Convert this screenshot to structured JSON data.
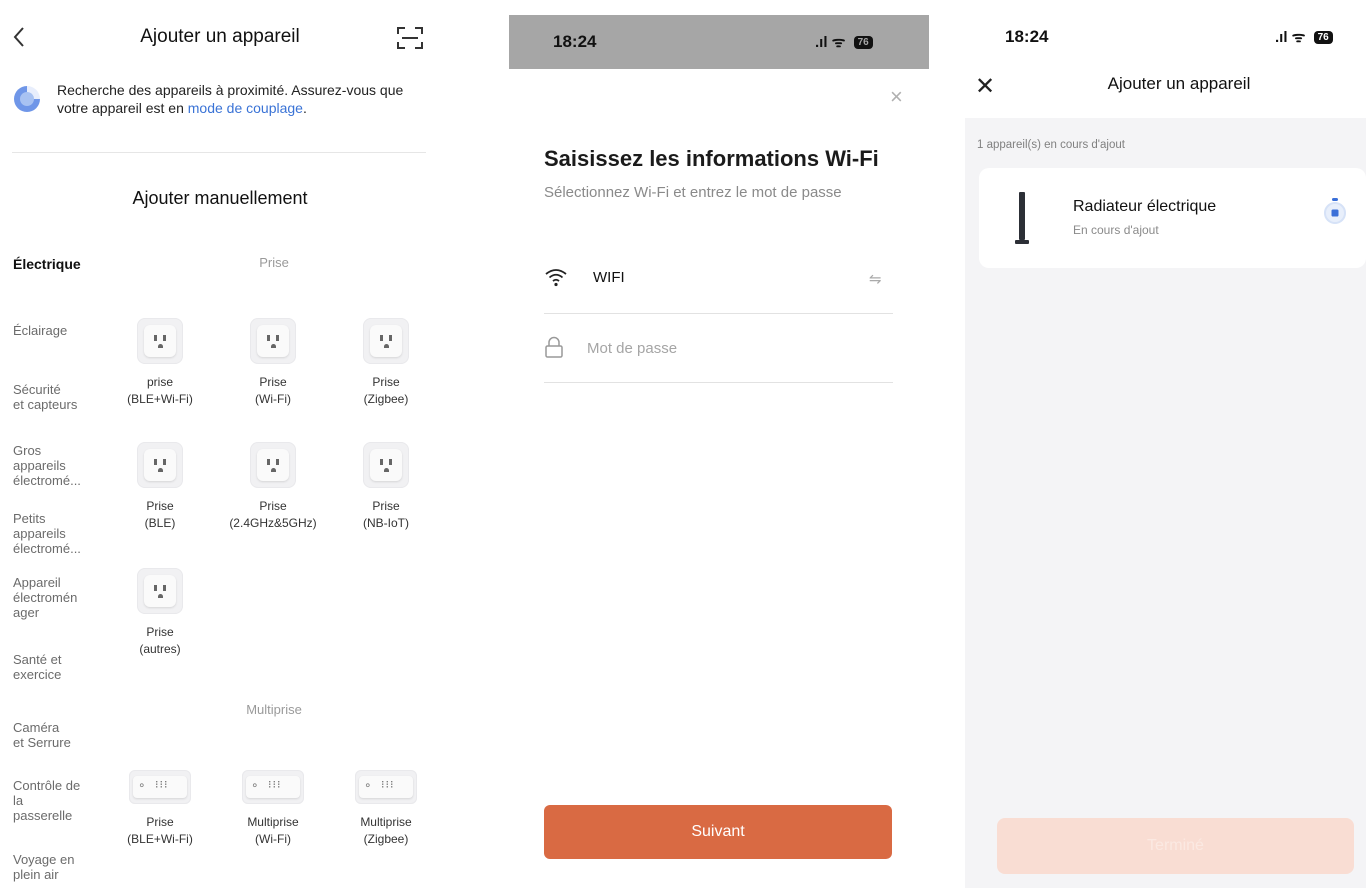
{
  "add_screen": {
    "title": "Ajouter un appareil",
    "notice_text": "Recherche des appareils à proximité. Assurez-vous que votre appareil est en ",
    "notice_link": "mode de couplage",
    "notice_end": ".",
    "manual_title": "Ajouter manuellement",
    "categories": [
      "Électrique",
      "Éclairage",
      "Sécurité\net capteurs",
      "Gros\nappareils\nélectromé...",
      "Petits\nappareils\nélectromé...",
      "Appareil\nélectromén\nager",
      "Santé et\nexercice",
      "Caméra\net Serrure",
      "Contrôle de\nla\npasserelle",
      "Voyage en\nplein air"
    ],
    "section_prise": "Prise",
    "section_multiprise": "Multiprise",
    "prise_devices": [
      "prise\n(BLE+Wi-Fi)",
      "Prise\n(Wi-Fi)",
      "Prise\n(Zigbee)",
      "Prise\n(BLE)",
      "Prise\n(2.4GHz&5GHz)",
      "Prise\n(NB-IoT)",
      "Prise\n(autres)"
    ],
    "multiprise_devices": [
      "Prise\n(BLE+Wi-Fi)",
      "Multiprise\n(Wi-Fi)",
      "Multiprise\n(Zigbee)"
    ],
    "icons": {
      "back": "chevron-left-icon",
      "scan": "scan-icon",
      "search": "searching-spinner-icon",
      "plug": "power-outlet-icon",
      "strip": "power-strip-icon"
    }
  },
  "wifi_screen": {
    "time": "18:24",
    "signal": ".ıl",
    "wifi_glyph": "ᯤ",
    "battery": "76",
    "close": "×",
    "title": "Saisissez les informations Wi-Fi",
    "subtitle": "Sélectionnez Wi-Fi et entrez le mot de passe",
    "network_name": "WIFI",
    "switch_glyph": "⇋",
    "password_placeholder": "Mot de passe",
    "button_label": "Suivant",
    "accent_color": "#d96a43"
  },
  "progress_screen": {
    "time": "18:24",
    "signal": ".ıl",
    "wifi_glyph": "ᯤ",
    "battery": "76",
    "close": "✕",
    "title": "Ajouter un appareil",
    "count_text": "1 appareil(s) en cours d'ajout",
    "device_name": "Radiateur électrique",
    "device_state": "En cours d'ajout",
    "button_label": "Terminé",
    "icons": {
      "device": "radiator-icon",
      "status": "loading-icon"
    }
  }
}
